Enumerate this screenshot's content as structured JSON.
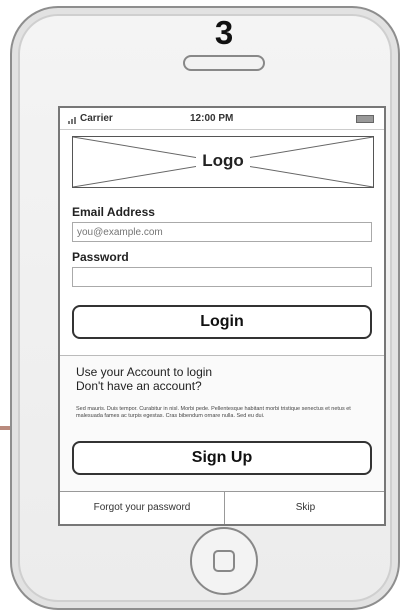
{
  "step": {
    "number": "3"
  },
  "status_bar": {
    "carrier": "Carrier",
    "time": "12:00 PM"
  },
  "logo": {
    "label": "Logo"
  },
  "form": {
    "email_label": "Email Address",
    "email_placeholder": "you@example.com",
    "password_label": "Password",
    "login_label": "Login"
  },
  "info": {
    "line1": "Use your Account to login",
    "line2": "Don't have an account?",
    "fine_print": "Sed mauris. Duis tempor. Curabitur in nisl. Morbi pede. Pellentesque habitant morbi tristique senectus et netus et malesuada fames ac turpis egestas. Cras bibendum ornare nulla. Sed eu dui.",
    "signup_label": "Sign Up"
  },
  "footer": {
    "forgot_label": "Forgot your password",
    "skip_label": "Skip"
  },
  "colors": {
    "accent_line": "#b98a7d",
    "phone_body": "#ececec",
    "outline": "#333333"
  }
}
